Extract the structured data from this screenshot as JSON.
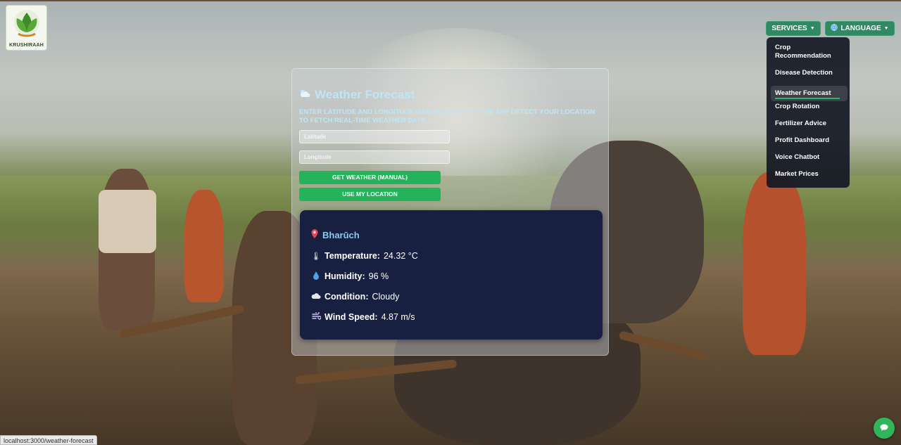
{
  "logo": {
    "text": "KRUSHIRAAH",
    "icon": "leaf-hands-icon"
  },
  "nav": {
    "services_label": "SERVICES",
    "language_label": "LANGUAGE",
    "language_icon": "globe-icon"
  },
  "services_menu": {
    "items": [
      "Crop Recommendation",
      "Disease Detection",
      "Weather Forecast",
      "Crop Rotation",
      "Fertilizer Advice",
      "Profit Dashboard",
      "Voice Chatbot",
      "Market Prices"
    ],
    "active": "Weather Forecast"
  },
  "weather": {
    "title": "Weather Forecast",
    "title_icon": "cloud-sun-icon",
    "subtitle": "Enter latitude and longitude manually or let the app detect your location to fetch real-time weather data.",
    "latitude_placeholder": "Latitude",
    "longitude_placeholder": "Longitude",
    "manual_button": "GET WEATHER (MANUAL)",
    "location_button": "USE MY LOCATION",
    "result": {
      "location": "Bharūch",
      "temperature_label": "Temperature:",
      "temperature_value": "24.32 °C",
      "humidity_label": "Humidity:",
      "humidity_value": "96 %",
      "condition_label": "Condition:",
      "condition_value": "Cloudy",
      "wind_label": "Wind Speed:",
      "wind_value": "4.87 m/s"
    }
  },
  "status_url": "localhost:3000/weather-forecast",
  "colors": {
    "accent_green": "#24b35a",
    "nav_green": "#2f8a64",
    "result_bg": "#172040",
    "title_blue": "#bfe6f7"
  }
}
